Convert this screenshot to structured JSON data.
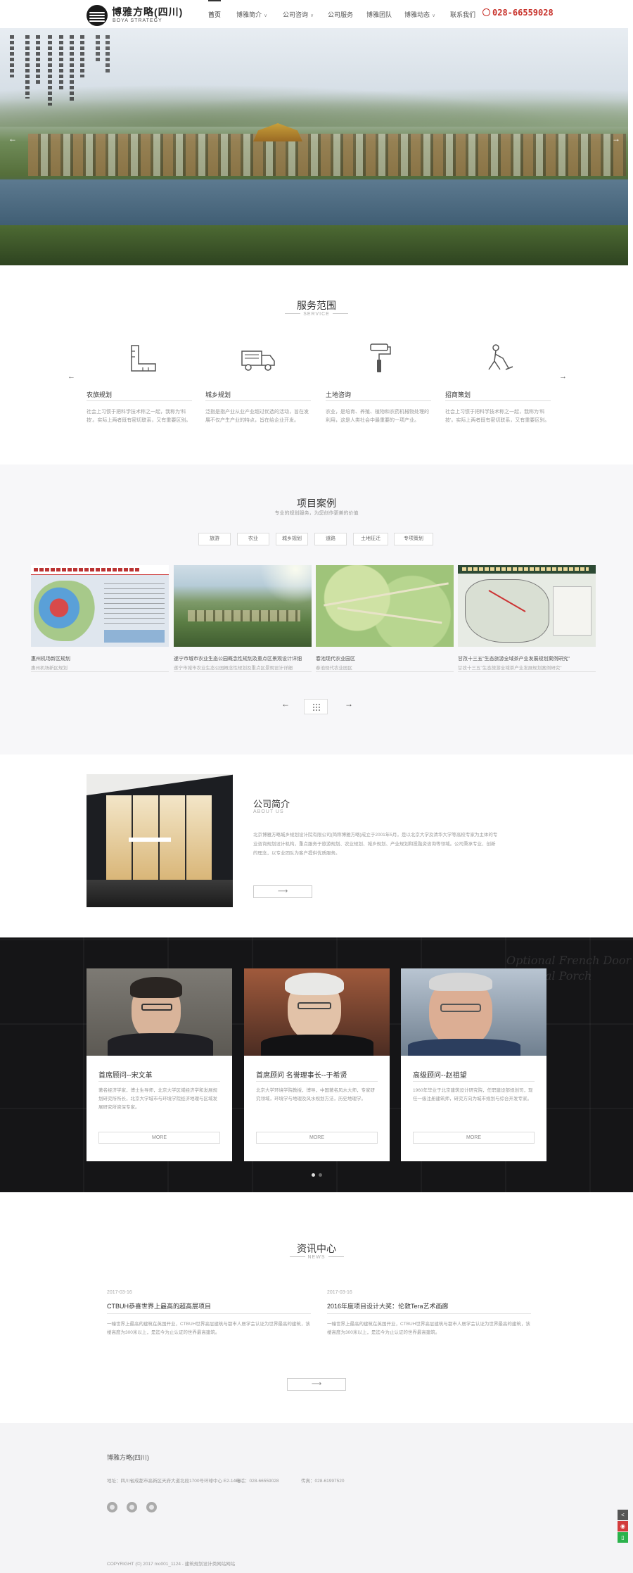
{
  "header": {
    "logo_cn": "博雅方略(四川)",
    "logo_en": "BOYA STRATEGY",
    "nav": [
      "首页",
      "博雅简介",
      "公司咨询",
      "公司服务",
      "博雅团队",
      "博雅动态",
      "联系我们"
    ],
    "phone": "028-66559028"
  },
  "services": {
    "title": "服务范围",
    "subtitle": "SERVICE",
    "items": [
      {
        "name": "农旅规划",
        "desc": "社会上习惯于把科学技术称之一起，我称为'科技'。实际上两者既有密切联系，又有重要区别。"
      },
      {
        "name": "城乡规划",
        "desc": "泛指是指产业从业产业超过优选的活动，旨在发展不仅产生产业的特点，旨在给企业开发。"
      },
      {
        "name": "土地咨询",
        "desc": "农业，是培育、养殖、植物和农药机械物处理的利用，这是人类社会中最重要的一项产业。"
      },
      {
        "name": "招商策划",
        "desc": "社会上习惯于把科学技术称之一起，我称为'科技'。实际上两者既有密切联系，又有重要区别。"
      }
    ]
  },
  "cases": {
    "title": "项目案例",
    "subtitle": "专业的规划服务，为您创作更美的价值",
    "tabs": [
      "旅游",
      "农业",
      "城乡规划",
      "道路",
      "土地征迁",
      "专项策划"
    ],
    "items": [
      {
        "title": "惠州机场新区规划",
        "sub": "惠州机场新区规划"
      },
      {
        "title": "遂宁市城市农业生态公园概念性规划及重点区景观设计详细",
        "sub": "遂宁市城市农业生态公园概念性规划及重点区景观设计详细"
      },
      {
        "title": "春池现代农业园区",
        "sub": "春池现代农业园区"
      },
      {
        "title": "甘孜十三五\"生态旅游全域茶产业发展规划案例研究\"",
        "sub": "甘孜十三五\"生态旅游全域茶产业发展规划案例研究\""
      }
    ]
  },
  "about": {
    "title": "公司简介",
    "subtitle": "ABOUT US",
    "text": "北京博雅方略城乡规划设计院有限公司(简称博雅方略)成立于2001年5月，是以北京大学及清华大学等高校专家为主体的专业咨询规划设计机构，重点服务于旅游规划、农业规划、城乡规划、产业规划和投融资咨询等领域。公司秉承专业、创新的理念，以专业团队为客户提供优质服务。"
  },
  "team": {
    "members": [
      {
        "name": "首席顾问--宋文革",
        "desc": "著名经济学家，博士生导师，北京大学区域经济学和发展规划研究所所长，北京大学城市与环境学院经济地理与区域发展研究所资深专家。"
      },
      {
        "name": "首席顾问  名誉理事长--于希贤",
        "desc": "北京大学环境学院教授，博导，中国著名风水大师，专家研究领域，环境学与地理及风水规划方法，历史地理学。"
      },
      {
        "name": "高级顾问--赵祖望",
        "desc": "1960年毕业于北京建筑设计研究院，任职建设部规划司，现任一级注册建筑师，研究方向为城市规划与综合开发专家。"
      }
    ],
    "more": "MORE"
  },
  "news": {
    "title": "资讯中心",
    "subtitle": "NEWS",
    "items": [
      {
        "date": "2017-03-16",
        "title": "CTBUH恭喜世界上最高的超高层项目",
        "desc": "一幢世界上最高的建筑在英国开业，CTBUH世界高层建筑与都市人居学会认证为世界最高的建筑，该楼高度为300米以上，是迄今为止认证的世界最高建筑。"
      },
      {
        "date": "2017-03-16",
        "title": "2016年度项目设计大奖：伦敦Tera艺术画廊",
        "desc": "一幢世界上最高的建筑在英国开业，CTBUH世界高层建筑与都市人居学会认证为世界最高的建筑，该楼高度为300米以上，是迄今为止认证的世界最高建筑。"
      }
    ]
  },
  "footer": {
    "company": "博雅方略(四川)",
    "address": "地址：四川省成都市高新区天府大道北段1700号环球中心 E2-1406",
    "tel": "电话：028-66559028",
    "fax": "传真：028-61997520",
    "copyright": "COPYRIGHT (©) 2017 mo001_1124 - 建筑规划设计类网站网站"
  },
  "colors": {
    "accent": "#c8322b",
    "dark": "#151517",
    "bg_light": "#f7f7f9"
  }
}
